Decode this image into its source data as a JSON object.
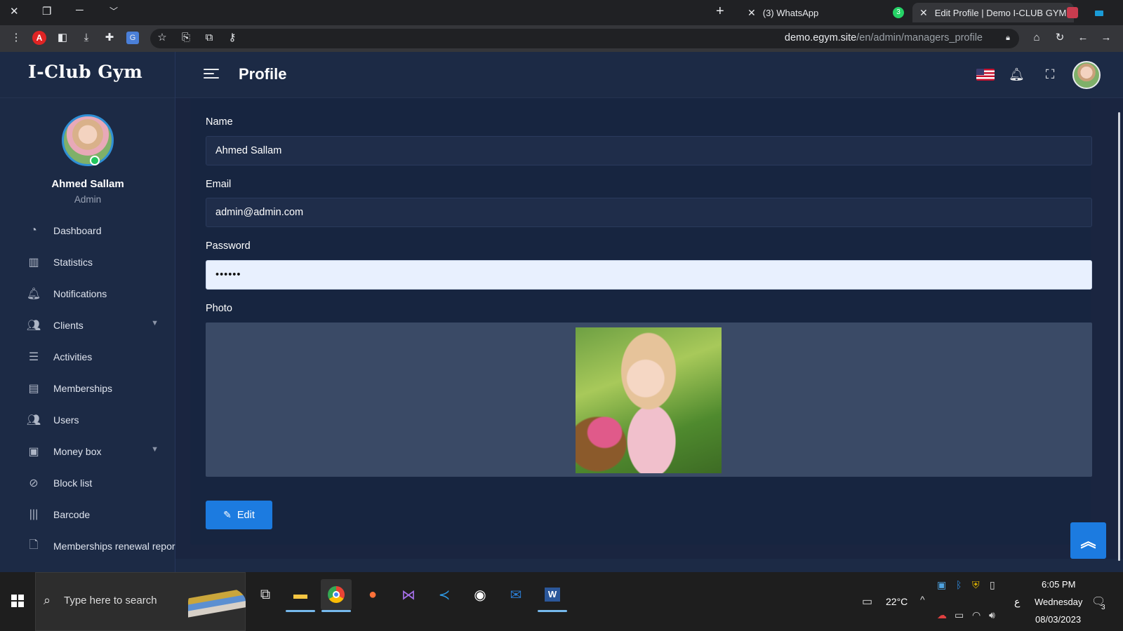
{
  "browser": {
    "tabs": [
      {
        "label": "(3) WhatsApp",
        "active": false
      },
      {
        "label": "Edit Profile | Demo I-CLUB GYM",
        "active": true
      }
    ],
    "whatsapp_badge": "3",
    "url_host": "demo.egym.site",
    "url_path": "/en/admin/managers_profile"
  },
  "header": {
    "logo": "I-Club Gym",
    "page_title": "Profile"
  },
  "sidebar": {
    "user_name": "Ahmed Sallam",
    "user_role": "Admin",
    "items": [
      {
        "label": "Dashboard",
        "icon": "dashboard-icon"
      },
      {
        "label": "Statistics",
        "icon": "bar-chart-icon"
      },
      {
        "label": "Notifications",
        "icon": "bell-icon"
      },
      {
        "label": "Clients",
        "icon": "users-icon",
        "expandable": true
      },
      {
        "label": "Activities",
        "icon": "list-icon"
      },
      {
        "label": "Memberships",
        "icon": "id-card-icon"
      },
      {
        "label": "Users",
        "icon": "users-icon"
      },
      {
        "label": "Money box",
        "icon": "money-icon",
        "expandable": true
      },
      {
        "label": "Block list",
        "icon": "ban-icon"
      },
      {
        "label": "Barcode",
        "icon": "barcode-icon"
      },
      {
        "label": "Memberships renewal repor",
        "icon": "file-icon"
      }
    ]
  },
  "form": {
    "name_label": "Name",
    "name_value": "Ahmed Sallam",
    "email_label": "Email",
    "email_value": "admin@admin.com",
    "password_label": "Password",
    "password_value": "••••••",
    "photo_label": "Photo",
    "edit_button": "Edit"
  },
  "taskbar": {
    "search_placeholder": "Type here to search",
    "weather": "22°C",
    "time": "6:05 PM",
    "day": "Wednesday",
    "date": "08/03/2023",
    "lang": "ع",
    "notif_count": "3"
  },
  "colors": {
    "accent": "#1c7be0",
    "sidebar_bg": "#1c2a45",
    "content_bg": "#172540",
    "online": "#22c55e"
  }
}
